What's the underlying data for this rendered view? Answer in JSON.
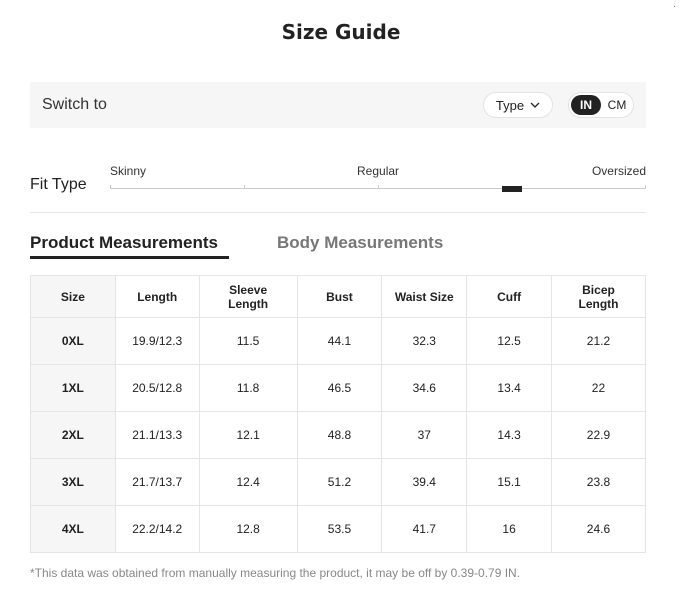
{
  "header": {
    "title": "Size Guide",
    "close_glyph": "·"
  },
  "switch_bar": {
    "label": "Switch to",
    "type_button": "Type",
    "units": {
      "active": "IN",
      "inactive": "CM"
    }
  },
  "fit_type": {
    "label": "Fit Type",
    "scale_labels": [
      "Skinny",
      "Regular",
      "Oversized"
    ],
    "selected_level": 0.75
  },
  "tabs": {
    "active": "Product Measurements",
    "inactive": "Body Measurements"
  },
  "table": {
    "headers": [
      "Size",
      "Length",
      "Sleeve Length",
      "Bust",
      "Waist Size",
      "Cuff",
      "Bicep Length"
    ],
    "rows": [
      [
        "0XL",
        "19.9/12.3",
        "11.5",
        "44.1",
        "32.3",
        "12.5",
        "21.2"
      ],
      [
        "1XL",
        "20.5/12.8",
        "11.8",
        "46.5",
        "34.6",
        "13.4",
        "22"
      ],
      [
        "2XL",
        "21.1/13.3",
        "12.1",
        "48.8",
        "37",
        "14.3",
        "22.9"
      ],
      [
        "3XL",
        "21.7/13.7",
        "12.4",
        "51.2",
        "39.4",
        "15.1",
        "23.8"
      ],
      [
        "4XL",
        "22.2/14.2",
        "12.8",
        "53.5",
        "41.7",
        "16",
        "24.6"
      ]
    ]
  },
  "footnote": "*This data was obtained from manually measuring the product, it may be off by 0.39-0.79 IN."
}
